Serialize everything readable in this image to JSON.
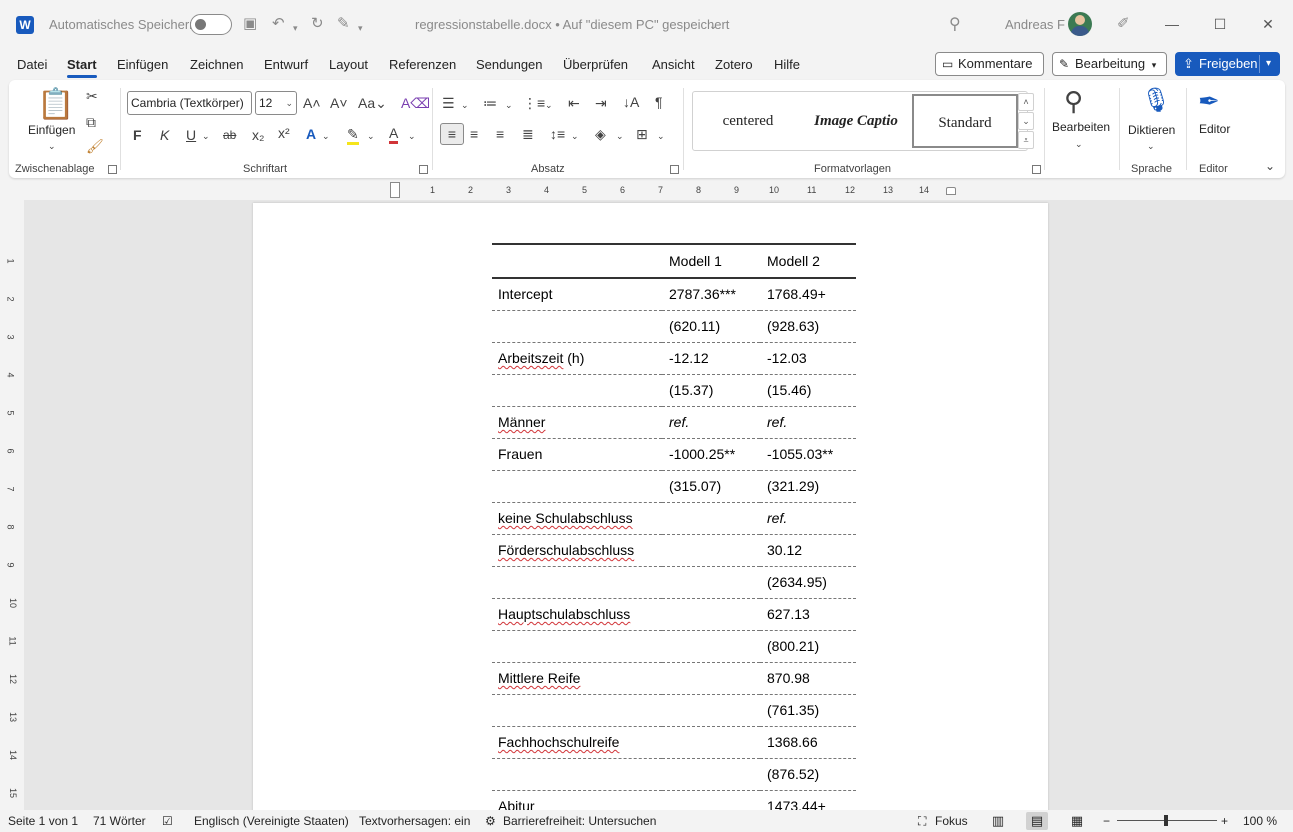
{
  "titlebar": {
    "app_icon_letter": "W",
    "autosave_label": "Automatisches Speichern",
    "document_title": "regressionstabelle.docx  •  Auf \"diesem PC\" gespeichert",
    "user_name": "Andreas F"
  },
  "menu": {
    "tabs": [
      "Datei",
      "Start",
      "Einfügen",
      "Zeichnen",
      "Entwurf",
      "Layout",
      "Referenzen",
      "Sendungen",
      "Überprüfen",
      "Ansicht",
      "Zotero",
      "Hilfe"
    ],
    "active_tab": "Start",
    "comments_label": "Kommentare",
    "editing_label": "Bearbeitung",
    "share_label": "Freigeben"
  },
  "ribbon": {
    "clipboard": {
      "paste_label": "Einfügen",
      "group_label": "Zwischenablage"
    },
    "font": {
      "font_name": "Cambria (Textkörper)",
      "font_size": "12",
      "bold": "F",
      "italic": "K",
      "underline": "U",
      "strike": "ab",
      "group_label": "Schriftart"
    },
    "paragraph": {
      "group_label": "Absatz"
    },
    "styles": {
      "items": [
        "centered",
        "Image Captio",
        "Standard"
      ],
      "selected": "Standard",
      "group_label": "Formatvorlagen"
    },
    "editing": {
      "label": "Bearbeiten"
    },
    "voice": {
      "label": "Diktieren",
      "group_label": "Sprache"
    },
    "editor": {
      "label": "Editor",
      "group_label": "Editor"
    }
  },
  "ruler": {
    "numbers": [
      "2",
      "1",
      "1",
      "2",
      "3",
      "4",
      "5",
      "6",
      "7",
      "8",
      "9",
      "10",
      "11",
      "12",
      "13",
      "14"
    ]
  },
  "vruler": {
    "numbers": [
      "1",
      "1",
      "2",
      "3",
      "4",
      "5",
      "6",
      "7",
      "8",
      "9",
      "10",
      "11",
      "12",
      "13",
      "14",
      "15"
    ]
  },
  "table": {
    "headers": [
      "",
      "Modell 1",
      "Modell 2"
    ],
    "rows": [
      [
        "Intercept",
        "2787.36***",
        "1768.49+"
      ],
      [
        "",
        "(620.11)",
        "(928.63)"
      ],
      [
        "Arbeitszeit (h)",
        "-12.12",
        "-12.03"
      ],
      [
        "",
        "(15.37)",
        "(15.46)"
      ],
      [
        "Männer",
        "ref.",
        "ref."
      ],
      [
        "Frauen",
        "-1000.25**",
        "-1055.03**"
      ],
      [
        "",
        "(315.07)",
        "(321.29)"
      ],
      [
        "keine Schulabschluss",
        "",
        "ref."
      ],
      [
        "Förderschulabschluss",
        "",
        "30.12"
      ],
      [
        "",
        "",
        "(2634.95)"
      ],
      [
        "Hauptschulabschluss",
        "",
        "627.13"
      ],
      [
        "",
        "",
        "(800.21)"
      ],
      [
        "Mittlere Reife",
        "",
        "870.98"
      ],
      [
        "",
        "",
        "(761.35)"
      ],
      [
        "Fachhochschulreife",
        "",
        "1368.66"
      ],
      [
        "",
        "",
        "(876.52)"
      ],
      [
        "Abitur",
        "",
        "1473.44+"
      ]
    ],
    "spellcheck_rows": [
      2,
      4,
      7,
      8,
      10,
      12,
      14
    ]
  },
  "statusbar": {
    "page": "Seite 1 von 1",
    "words": "71 Wörter",
    "language": "Englisch (Vereinigte Staaten)",
    "predictions": "Textvorhersagen: ein",
    "accessibility": "Barrierefreiheit: Untersuchen",
    "focus": "Fokus",
    "zoom": "100 %"
  },
  "colors": {
    "accent": "#185abd",
    "spellcheck": "#d13438"
  }
}
